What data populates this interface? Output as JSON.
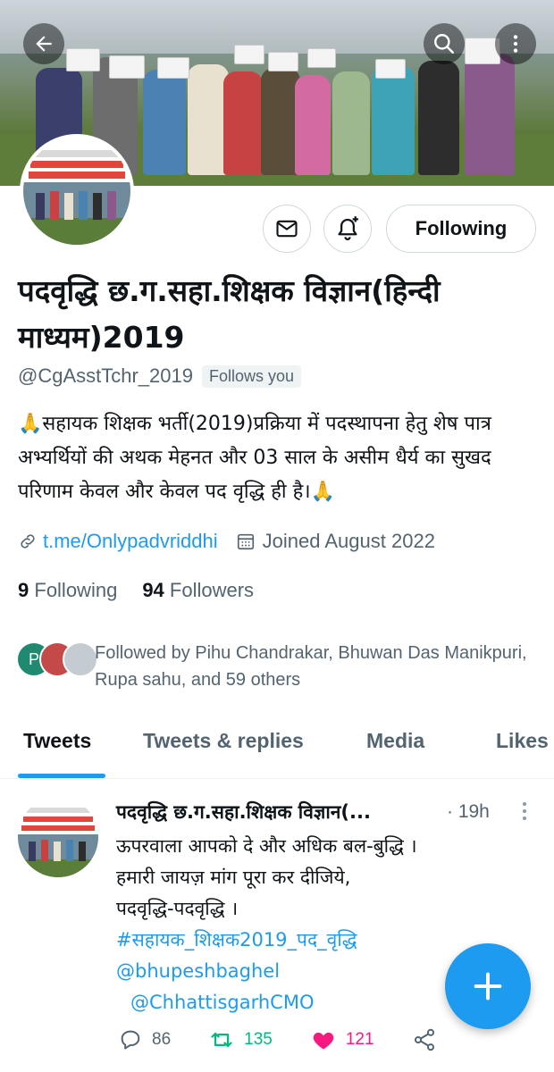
{
  "header": {
    "back_icon": "arrow-left-icon",
    "search_icon": "search-icon",
    "more_icon": "more-vertical-icon"
  },
  "profile": {
    "name": "पदवृद्धि छ.ग.सहा.शिक्षक विज्ञान(हिन्दी माध्यम)2019",
    "handle": "@CgAsstTchr_2019",
    "follows_you": "Follows you",
    "bio": "🙏सहायक शिक्षक भर्ती(2019)प्रक्रिया में पदस्थापना हेतु शेष पात्र अभ्यर्थियों की अथक मेहनत और 03 साल के असीम धैर्य का सुखद परिणाम केवल और केवल पद वृद्धि ही है।🙏",
    "link": "t.me/Onlypadvriddhi",
    "joined": "Joined August 2022",
    "following_count": "9",
    "following_label": "Following",
    "followers_count": "94",
    "followers_label": "Followers",
    "followed_by": "Followed by Pihu Chandrakar, Bhuwan Das Manikpuri, Rupa sahu, and 59 others",
    "follow_button": "Following",
    "followed_avatar_letter": "P"
  },
  "tabs": [
    "Tweets",
    "Tweets & replies",
    "Media",
    "Likes"
  ],
  "tweet": {
    "author": "पदवृद्धि छ.ग.सहा.शिक्षक विज्ञान(...",
    "time": "· 19h",
    "line1": "ऊपरवाला आपको दे और अधिक बल-बुद्धि ।",
    "line2": "हमारी जायज़ मांग पूरा कर दीजिये,",
    "line3": "पदवृद्धि-पदवृद्धि ।",
    "hashtag": "#सहायक_शिक्षक2019_पद_वृद्धि",
    "mention1": "@bhupeshbaghel",
    "mention2": "@ChhattisgarhCMO",
    "replies": "86",
    "retweets": "135",
    "likes": "121"
  },
  "colors": {
    "accent": "#1d9bf0",
    "retweet": "#00ba7c",
    "like": "#f91880"
  }
}
